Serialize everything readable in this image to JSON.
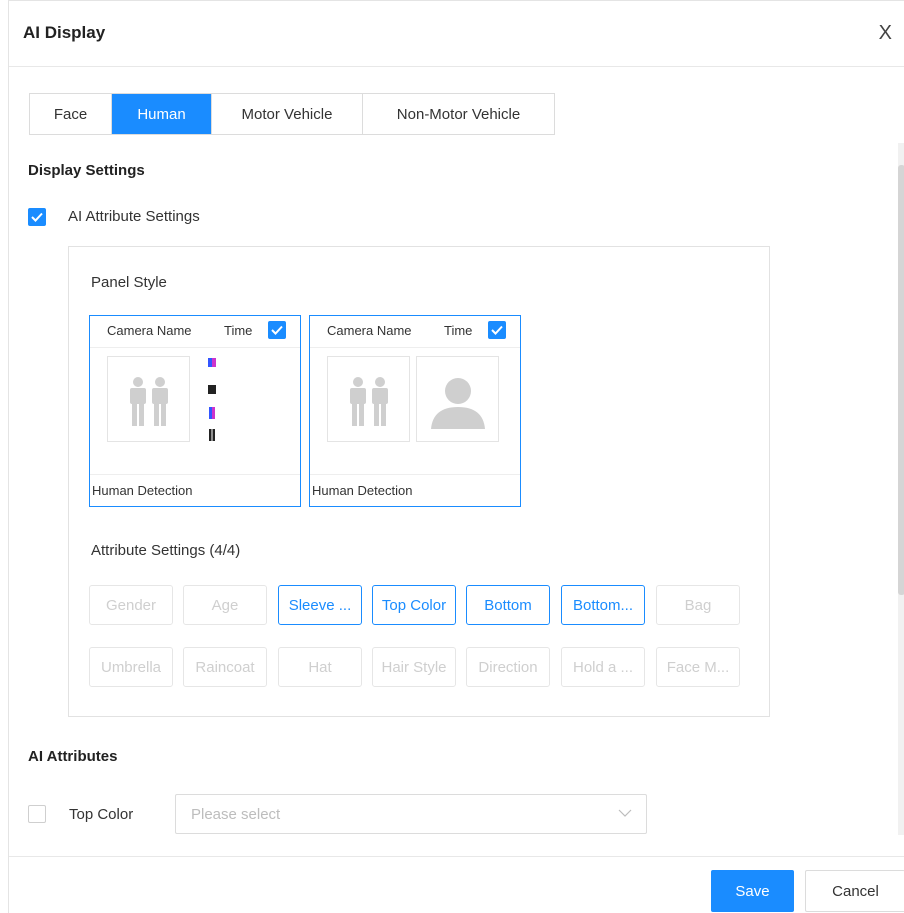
{
  "dialog": {
    "title": "AI Display",
    "close_label": "X"
  },
  "tabs": [
    {
      "label": "Face",
      "active": false
    },
    {
      "label": "Human",
      "active": true
    },
    {
      "label": "Motor Vehicle",
      "active": false
    },
    {
      "label": "Non-Motor Vehicle",
      "active": false
    }
  ],
  "display_settings": {
    "title": "Display Settings",
    "ai_attribute_settings": {
      "label": "AI Attribute Settings",
      "checked": true
    },
    "panel_style": {
      "label": "Panel Style",
      "cards": [
        {
          "camera_name": "Camera Name",
          "time": "Time",
          "time_checked": true,
          "footer": "Human Detection",
          "variant": "attributes"
        },
        {
          "camera_name": "Camera Name",
          "time": "Time",
          "time_checked": true,
          "footer": "Human Detection",
          "variant": "face"
        }
      ]
    },
    "attribute_settings": {
      "label": "Attribute Settings (4/4)",
      "items": [
        {
          "label": "Gender",
          "selected": false
        },
        {
          "label": "Age",
          "selected": false
        },
        {
          "label": "Sleeve ...",
          "selected": true
        },
        {
          "label": "Top Color",
          "selected": true
        },
        {
          "label": "Bottom",
          "selected": true
        },
        {
          "label": "Bottom...",
          "selected": true
        },
        {
          "label": "Bag",
          "selected": false
        },
        {
          "label": "Umbrella",
          "selected": false
        },
        {
          "label": "Raincoat",
          "selected": false
        },
        {
          "label": "Hat",
          "selected": false
        },
        {
          "label": "Hair Style",
          "selected": false
        },
        {
          "label": "Direction",
          "selected": false
        },
        {
          "label": "Hold a ...",
          "selected": false
        },
        {
          "label": "Face M...",
          "selected": false
        }
      ]
    }
  },
  "ai_attributes": {
    "title": "AI Attributes",
    "top_color": {
      "label": "Top Color",
      "checked": false,
      "placeholder": "Please select"
    }
  },
  "footer": {
    "save_label": "Save",
    "cancel_label": "Cancel"
  },
  "colors": {
    "accent": "#1a8cff",
    "border": "#dcdcdc",
    "disabled_text": "#cfcfcf"
  }
}
